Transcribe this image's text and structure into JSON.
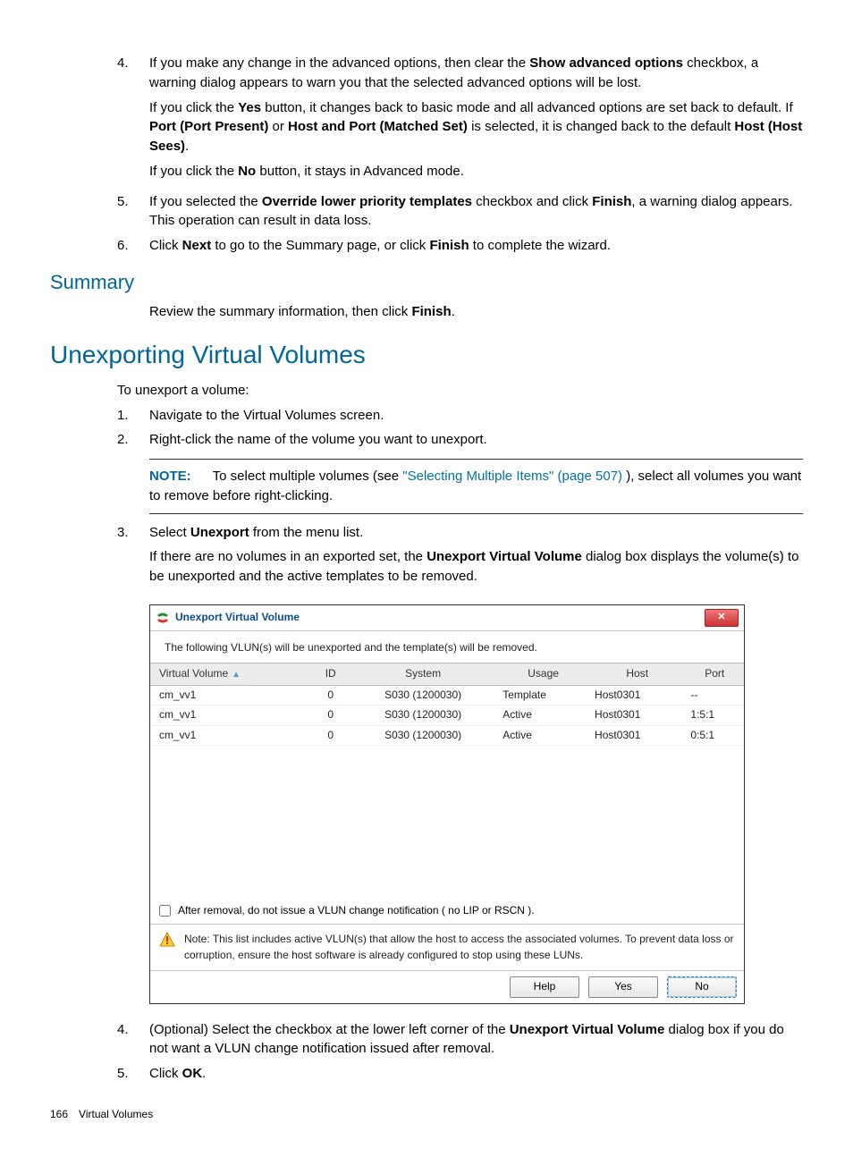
{
  "list1": {
    "item4": {
      "num": "4.",
      "p1a": "If you make any change in the advanced options, then clear the ",
      "p1b": "Show advanced options",
      "p1c": " checkbox, a warning dialog appears to warn you that the selected advanced options will be lost.",
      "p2a": "If you click the ",
      "p2b": "Yes",
      "p2c": " button, it changes back to basic mode and all advanced options are set back to default. If ",
      "p2d": "Port (Port Present)",
      "p2e": " or ",
      "p2f": "Host and Port (Matched Set)",
      "p2g": " is selected, it is changed back to the default ",
      "p2h": "Host (Host Sees)",
      "p2i": ".",
      "p3a": "If you click the ",
      "p3b": "No",
      "p3c": " button, it stays in Advanced mode."
    },
    "item5": {
      "num": "5.",
      "a": "If you selected the ",
      "b": "Override lower priority templates",
      "c": " checkbox and click ",
      "d": "Finish",
      "e": ", a warning dialog appears. This operation can result in data loss."
    },
    "item6": {
      "num": "6.",
      "a": "Click ",
      "b": "Next",
      "c": " to go to the Summary page, or click ",
      "d": "Finish",
      "e": " to complete the wizard."
    }
  },
  "summary": {
    "heading": "Summary",
    "p1a": "Review the summary information, then click ",
    "p1b": "Finish",
    "p1c": "."
  },
  "unexport": {
    "heading": "Unexporting Virtual Volumes",
    "intro": "To unexport a volume:",
    "s1": {
      "num": "1.",
      "text": "Navigate to the Virtual Volumes screen."
    },
    "s2": {
      "num": "2.",
      "text": "Right-click the name of the volume you want to unexport."
    },
    "note": {
      "label": "NOTE:",
      "a": "To select multiple volumes (see ",
      "link": "\"Selecting Multiple Items\" (page 507)",
      "b": " ), select all volumes you want to remove before right-clicking."
    },
    "s3": {
      "num": "3.",
      "a": "Select ",
      "b": "Unexport",
      "c": " from the menu list.",
      "p2a": "If there are no volumes in an exported set, the ",
      "p2b": "Unexport Virtual Volume",
      "p2c": " dialog box displays the volume(s) to be unexported and the active templates to be removed."
    },
    "s4": {
      "num": "4.",
      "a": "(Optional) Select the checkbox at the lower left corner of the ",
      "b": "Unexport Virtual Volume",
      "c": " dialog box if you do not want a VLUN change notification issued after removal."
    },
    "s5": {
      "num": "5.",
      "a": "Click ",
      "b": "OK",
      "c": "."
    }
  },
  "dialog": {
    "title": "Unexport Virtual Volume",
    "msg": "The following VLUN(s) will be unexported and the template(s) will be removed.",
    "headers": {
      "vv": "Virtual Volume",
      "id": "ID",
      "system": "System",
      "usage": "Usage",
      "host": "Host",
      "port": "Port"
    },
    "rows": [
      {
        "vv": "cm_vv1",
        "id": "0",
        "system": "S030 (1200030)",
        "usage": "Template",
        "host": "Host0301",
        "port": "--"
      },
      {
        "vv": "cm_vv1",
        "id": "0",
        "system": "S030 (1200030)",
        "usage": "Active",
        "host": "Host0301",
        "port": "1:5:1"
      },
      {
        "vv": "cm_vv1",
        "id": "0",
        "system": "S030 (1200030)",
        "usage": "Active",
        "host": "Host0301",
        "port": "0:5:1"
      }
    ],
    "checkbox": "After removal, do not issue a VLUN change notification ( no LIP or RSCN ).",
    "warn": "Note: This list includes active VLUN(s) that allow the host to access the associated volumes. To prevent data loss or corruption, ensure the host software is already configured to stop using these LUNs.",
    "buttons": {
      "help": "Help",
      "yes": "Yes",
      "no": "No"
    }
  },
  "footer": {
    "page": "166",
    "section": "Virtual Volumes"
  }
}
